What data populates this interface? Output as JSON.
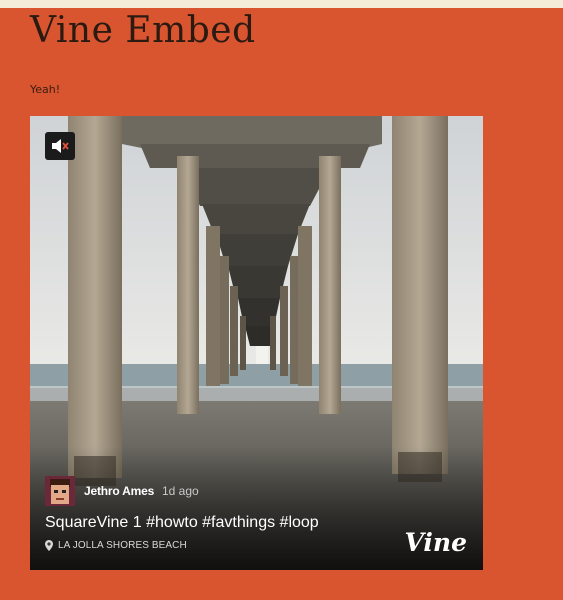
{
  "post": {
    "title": "Vine Embed",
    "text": "Yeah!"
  },
  "vine": {
    "author": "Jethro Ames",
    "time_ago": "1d ago",
    "caption": "SquareVine 1 #howto #favthings #loop",
    "location": "LA JOLLA SHORES BEACH",
    "logo": "Vine",
    "icons": {
      "mute": "speaker-muted-icon",
      "location": "map-pin-icon"
    }
  },
  "colors": {
    "page_background": "#d9552f",
    "title_text": "#2a1a12"
  }
}
